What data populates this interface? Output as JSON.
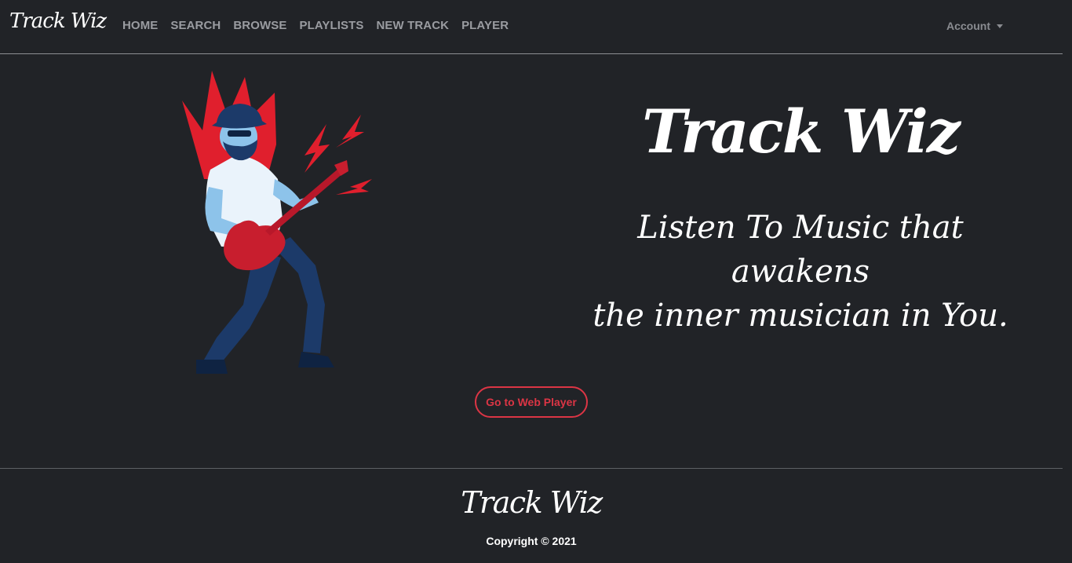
{
  "navbar": {
    "brand": "Track Wiz",
    "links": [
      "HOME",
      "SEARCH",
      "BROWSE",
      "PLAYLISTS",
      "NEW TRACK",
      "PLAYER"
    ],
    "account_label": "Account"
  },
  "hero": {
    "title": "Track Wiz",
    "tagline_line1": "Listen To Music that awakens",
    "tagline_line2": "the inner musician in You.",
    "cta_label": "Go to Web Player",
    "illustration_icon": "guitarist-illustration"
  },
  "footer": {
    "brand": "Track Wiz",
    "copyright": "Copyright © 2021"
  },
  "colors": {
    "background": "#212327",
    "accent_red": "#dc3545",
    "nav_text": "#9a9ca1"
  }
}
